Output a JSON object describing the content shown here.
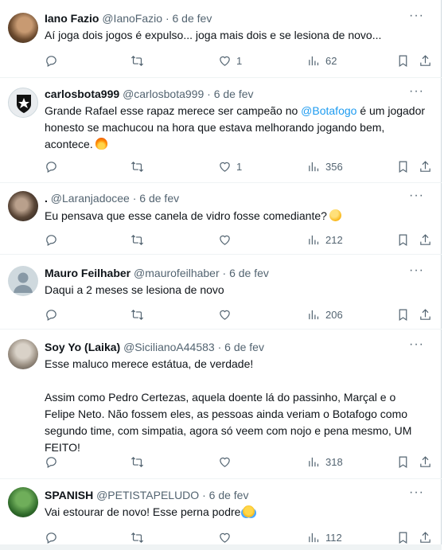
{
  "tweets": [
    {
      "name": "Iano Fazio",
      "handle": "@IanoFazio",
      "date": "6 de fev",
      "text": "Aí joga dois jogos é expulso... joga mais dois e se lesiona de novo...",
      "likes": "1",
      "views": "62"
    },
    {
      "name": "carlosbota999",
      "handle": "@carlosbota999",
      "date": "6 de fev",
      "text_before": "Grande Rafael esse rapaz merece ser campeão no ",
      "mention": "@Botafogo",
      "text_after": " é um jogador",
      "line2": "honesto se machucou na hora que estava melhorando jogando bem,",
      "line3": "acontece.",
      "likes": "1",
      "views": "356"
    },
    {
      "name": ".",
      "handle": "@Laranjadocee",
      "date": "6 de fev",
      "text": "Eu pensava que esse canela de vidro fosse comediante?",
      "views": "212"
    },
    {
      "name": "Mauro Feilhaber",
      "handle": "@maurofeilhaber",
      "date": "6 de fev",
      "text": "Daqui a 2 meses se lesiona de novo",
      "views": "206"
    },
    {
      "name": "Soy Yo (Laika)",
      "handle": "@SicilianoA44583",
      "date": "6 de fev",
      "line1": "Esse maluco merece estátua, de verdade!",
      "line2": "Assim como Pedro Certezas, aquela doente lá do passinho, Marçal e o",
      "line3": "Felipe Neto. Não fossem eles, as pessoas ainda veriam o Botafogo como",
      "line4": "segundo time, com simpatia, agora só veem com nojo e pena mesmo, UM",
      "line5": "FEITO!",
      "views": "318"
    },
    {
      "name": "SPANISH",
      "handle": "@PETISTAPELUDO",
      "date": "6 de fev",
      "text": "Vai estourar de novo! Esse perna podre",
      "views": "112"
    }
  ],
  "colors": {
    "text": "#0f1419",
    "secondary": "#536471",
    "accent": "#1d9bf0",
    "divider": "#eff3f4"
  },
  "icons": [
    "reply-icon",
    "retweet-icon",
    "like-icon",
    "views-icon",
    "bookmark-icon",
    "share-icon",
    "more-icon"
  ]
}
